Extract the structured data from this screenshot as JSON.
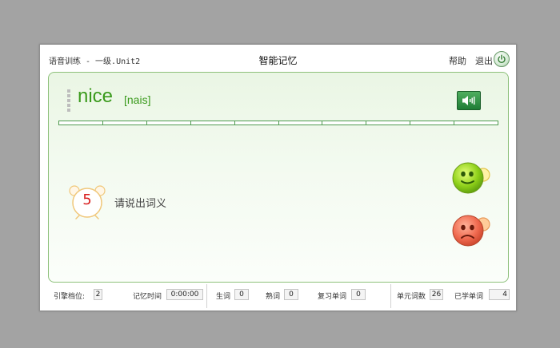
{
  "header": {
    "app_title": "语音训练 - 一级.Unit2",
    "mode_title": "智能记忆",
    "help_label": "帮助",
    "exit_label": "退出"
  },
  "word_card": {
    "word": "nice",
    "phonetic": "[nais]",
    "countdown": "5",
    "prompt": "请说出词义",
    "progress_segments": 10
  },
  "status": {
    "engine_level_label": "引擎档位:",
    "engine_level_value": "2",
    "memory_time_label": "记忆时间",
    "memory_time_value": "0:00:00",
    "new_words_label": "生词",
    "new_words_value": "0",
    "known_words_label": "熟词",
    "known_words_value": "0",
    "review_words_label": "复习单词",
    "review_words_value": "0",
    "unit_word_count_label": "单元词数",
    "unit_word_count_value": "26",
    "learned_words_label": "已学单词",
    "learned_words_value": "4"
  },
  "colors": {
    "word": "#3a9a1c",
    "countdown": "#d81f1f",
    "card_border": "#8dc07a"
  },
  "icons": {
    "power": "power-icon",
    "speaker": "speaker-icon",
    "clock": "alarm-clock-icon",
    "yes": "happy-face-icon",
    "no": "sad-face-icon"
  }
}
